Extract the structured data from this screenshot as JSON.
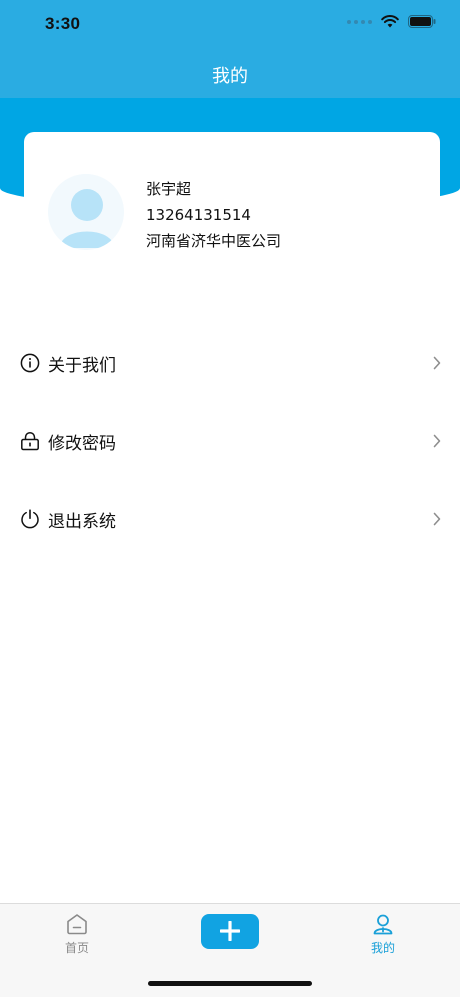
{
  "status_bar": {
    "time": "3:30"
  },
  "header": {
    "title": "我的"
  },
  "profile": {
    "name": "张宇超",
    "phone": "13264131514",
    "company": "河南省济华中医公司"
  },
  "menu": [
    {
      "label": "关于我们",
      "icon": "info-icon"
    },
    {
      "label": "修改密码",
      "icon": "lock-icon"
    },
    {
      "label": "退出系统",
      "icon": "power-icon"
    }
  ],
  "tabbar": {
    "home_label": "首页",
    "mine_label": "我的",
    "active_tab": "我的"
  },
  "colors": {
    "header": "#2aace2",
    "accent": "#00a6e4",
    "tab_active": "#1aa0d8"
  }
}
